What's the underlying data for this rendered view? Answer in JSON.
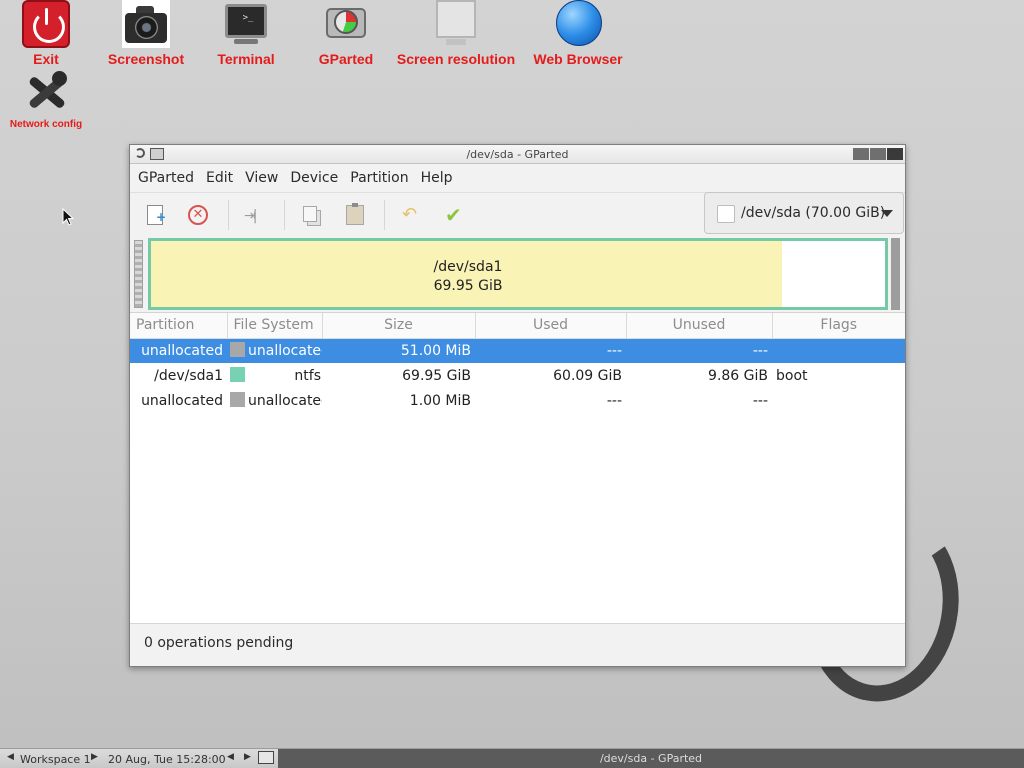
{
  "desktop": {
    "icons": [
      {
        "label": "Exit",
        "icon": "power-icon"
      },
      {
        "label": "Screenshot",
        "icon": "camera-icon"
      },
      {
        "label": "Terminal",
        "icon": "terminal-icon"
      },
      {
        "label": "GParted",
        "icon": "gparted-icon"
      },
      {
        "label": "Screen resolution",
        "icon": "monitor-icon"
      },
      {
        "label": "Web Browser",
        "icon": "globe-icon"
      },
      {
        "label": "Network config",
        "icon": "tools-icon"
      }
    ],
    "label_color": "#e51b1b"
  },
  "window": {
    "title": "/dev/sda - GParted",
    "menu": [
      "GParted",
      "Edit",
      "View",
      "Device",
      "Partition",
      "Help"
    ],
    "toolbar": {
      "buttons": [
        "new-icon",
        "delete-icon",
        "resize-move-icon",
        "copy-icon",
        "paste-icon",
        "undo-icon",
        "apply-icon"
      ]
    },
    "device_selector": "/dev/sda  (70.00 GiB)",
    "graph": {
      "name": "/dev/sda1",
      "size": "69.95 GiB",
      "used_fraction": 0.859,
      "used_color": "#f9f3b6",
      "border_color": "#76c9a7"
    },
    "table": {
      "headers": [
        "Partition",
        "File System",
        "Size",
        "Used",
        "Unused",
        "Flags"
      ],
      "rows": [
        {
          "partition": "unallocated",
          "fs": "unallocated",
          "fs_color": "#a8a8a8",
          "size": "51.00 MiB",
          "used": "---",
          "unused": "---",
          "flags": "",
          "selected": true
        },
        {
          "partition": "/dev/sda1",
          "fs": "ntfs",
          "fs_color": "#76d2b2",
          "size": "69.95 GiB",
          "used": "60.09 GiB",
          "unused": "9.86 GiB",
          "flags": "boot",
          "selected": false
        },
        {
          "partition": "unallocated",
          "fs": "unallocated",
          "fs_color": "#a8a8a8",
          "size": "1.00 MiB",
          "used": "---",
          "unused": "---",
          "flags": "",
          "selected": false
        }
      ],
      "selection_color": "#3d8de3"
    },
    "status": "0 operations pending"
  },
  "taskbar": {
    "workspace": "Workspace 1",
    "clock": "20 Aug, Tue 15:28:00",
    "task_title": "/dev/sda - GParted"
  }
}
